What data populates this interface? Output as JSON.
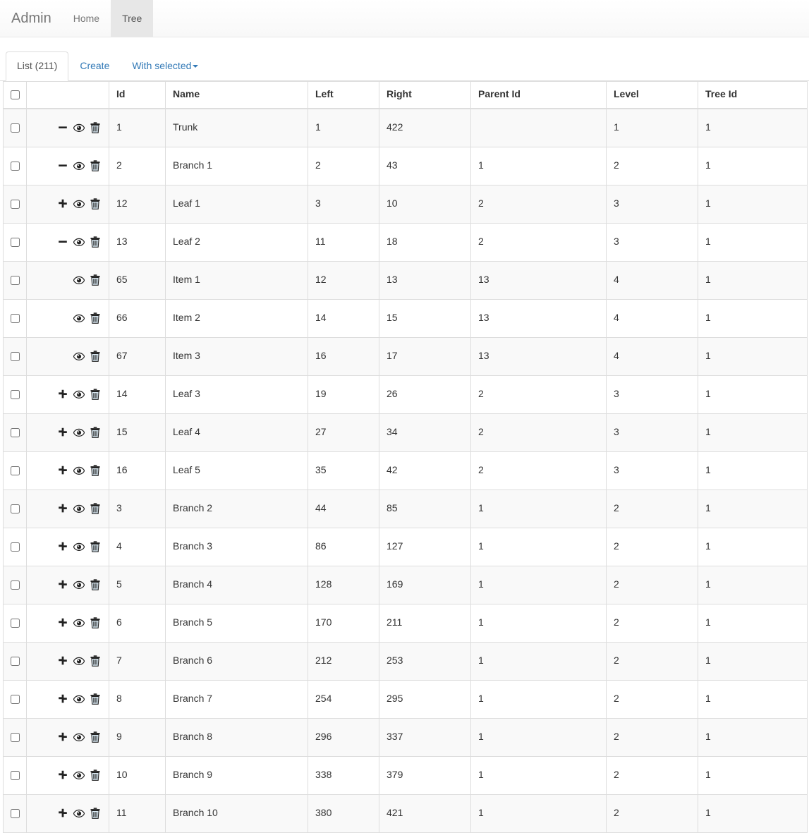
{
  "navbar": {
    "brand": "Admin",
    "items": [
      {
        "label": "Home",
        "active": false
      },
      {
        "label": "Tree",
        "active": true
      }
    ]
  },
  "tabs": [
    {
      "label": "List (211)",
      "active": true
    },
    {
      "label": "Create",
      "active": false
    },
    {
      "label": "With selected",
      "active": false,
      "caret": true
    }
  ],
  "colors": {
    "link": "#337ab7",
    "navbar_bg": "#f8f8f8",
    "navbar_active_bg": "#e7e7e7",
    "stripe": "#f9f9f9",
    "border": "#dddddd",
    "text": "#333333"
  },
  "table": {
    "columns": [
      {
        "key": "check",
        "label": ""
      },
      {
        "key": "actions",
        "label": ""
      },
      {
        "key": "id",
        "label": "Id"
      },
      {
        "key": "name",
        "label": "Name"
      },
      {
        "key": "left",
        "label": "Left"
      },
      {
        "key": "right",
        "label": "Right"
      },
      {
        "key": "parent",
        "label": "Parent Id"
      },
      {
        "key": "level",
        "label": "Level"
      },
      {
        "key": "tree",
        "label": "Tree Id"
      }
    ],
    "icons": {
      "expand": "plus-icon",
      "collapse": "minus-icon",
      "view": "eye-icon",
      "delete": "trash-icon",
      "select_all": "select-all-checkbox"
    },
    "rows": [
      {
        "toggle": "minus",
        "indent": 1,
        "id": "1",
        "name": "Trunk",
        "left": "1",
        "right": "422",
        "parent": "",
        "level": "1",
        "tree": "1"
      },
      {
        "toggle": "minus",
        "indent": 2,
        "id": "2",
        "name": "Branch 1",
        "left": "2",
        "right": "43",
        "parent": "1",
        "level": "2",
        "tree": "1"
      },
      {
        "toggle": "plus",
        "indent": 3,
        "id": "12",
        "name": "Leaf 1",
        "left": "3",
        "right": "10",
        "parent": "2",
        "level": "3",
        "tree": "1"
      },
      {
        "toggle": "minus",
        "indent": 3,
        "id": "13",
        "name": "Leaf 2",
        "left": "11",
        "right": "18",
        "parent": "2",
        "level": "3",
        "tree": "1"
      },
      {
        "toggle": "none",
        "indent": 4,
        "id": "65",
        "name": "Item 1",
        "left": "12",
        "right": "13",
        "parent": "13",
        "level": "4",
        "tree": "1"
      },
      {
        "toggle": "none",
        "indent": 4,
        "id": "66",
        "name": "Item 2",
        "left": "14",
        "right": "15",
        "parent": "13",
        "level": "4",
        "tree": "1"
      },
      {
        "toggle": "none",
        "indent": 4,
        "id": "67",
        "name": "Item 3",
        "left": "16",
        "right": "17",
        "parent": "13",
        "level": "4",
        "tree": "1"
      },
      {
        "toggle": "plus",
        "indent": 3,
        "id": "14",
        "name": "Leaf 3",
        "left": "19",
        "right": "26",
        "parent": "2",
        "level": "3",
        "tree": "1"
      },
      {
        "toggle": "plus",
        "indent": 3,
        "id": "15",
        "name": "Leaf 4",
        "left": "27",
        "right": "34",
        "parent": "2",
        "level": "3",
        "tree": "1"
      },
      {
        "toggle": "plus",
        "indent": 3,
        "id": "16",
        "name": "Leaf 5",
        "left": "35",
        "right": "42",
        "parent": "2",
        "level": "3",
        "tree": "1"
      },
      {
        "toggle": "plus",
        "indent": 2,
        "id": "3",
        "name": "Branch 2",
        "left": "44",
        "right": "85",
        "parent": "1",
        "level": "2",
        "tree": "1"
      },
      {
        "toggle": "plus",
        "indent": 2,
        "id": "4",
        "name": "Branch 3",
        "left": "86",
        "right": "127",
        "parent": "1",
        "level": "2",
        "tree": "1"
      },
      {
        "toggle": "plus",
        "indent": 2,
        "id": "5",
        "name": "Branch 4",
        "left": "128",
        "right": "169",
        "parent": "1",
        "level": "2",
        "tree": "1"
      },
      {
        "toggle": "plus",
        "indent": 2,
        "id": "6",
        "name": "Branch 5",
        "left": "170",
        "right": "211",
        "parent": "1",
        "level": "2",
        "tree": "1"
      },
      {
        "toggle": "plus",
        "indent": 2,
        "id": "7",
        "name": "Branch 6",
        "left": "212",
        "right": "253",
        "parent": "1",
        "level": "2",
        "tree": "1"
      },
      {
        "toggle": "plus",
        "indent": 2,
        "id": "8",
        "name": "Branch 7",
        "left": "254",
        "right": "295",
        "parent": "1",
        "level": "2",
        "tree": "1"
      },
      {
        "toggle": "plus",
        "indent": 2,
        "id": "9",
        "name": "Branch 8",
        "left": "296",
        "right": "337",
        "parent": "1",
        "level": "2",
        "tree": "1"
      },
      {
        "toggle": "plus",
        "indent": 2,
        "id": "10",
        "name": "Branch 9",
        "left": "338",
        "right": "379",
        "parent": "1",
        "level": "2",
        "tree": "1"
      },
      {
        "toggle": "plus",
        "indent": 2,
        "id": "11",
        "name": "Branch 10",
        "left": "380",
        "right": "421",
        "parent": "1",
        "level": "2",
        "tree": "1"
      }
    ]
  }
}
